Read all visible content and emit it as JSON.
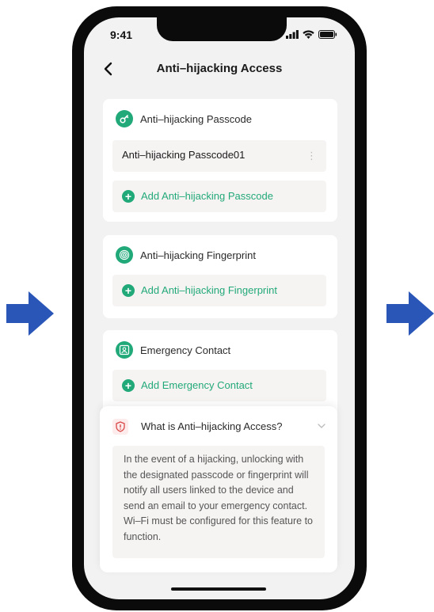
{
  "status_bar": {
    "time": "9:41"
  },
  "header": {
    "title": "Anti–hijacking Access"
  },
  "passcode_section": {
    "title": "Anti–hijacking Passcode",
    "items": [
      {
        "label": "Anti–hijacking Passcode01"
      }
    ],
    "add_label": "Add Anti–hijacking Passcode"
  },
  "fingerprint_section": {
    "title": "Anti–hijacking Fingerprint",
    "add_label": "Add Anti–hijacking Fingerprint"
  },
  "contact_section": {
    "title": "Emergency Contact",
    "add_label": "Add Emergency Contact"
  },
  "info_panel": {
    "title": "What is Anti–hijacking Access?",
    "body": "In the event of a hijacking, unlocking with the designated passcode or fingerprint will notify all users linked to the device and send an email to your emergency contact. Wi–Fi must be configured for this feature to function."
  },
  "colors": {
    "accent": "#22a97a",
    "arrow": "#2a56b8",
    "warning": "#d94a4a",
    "screen_bg": "#f2f2f2"
  }
}
